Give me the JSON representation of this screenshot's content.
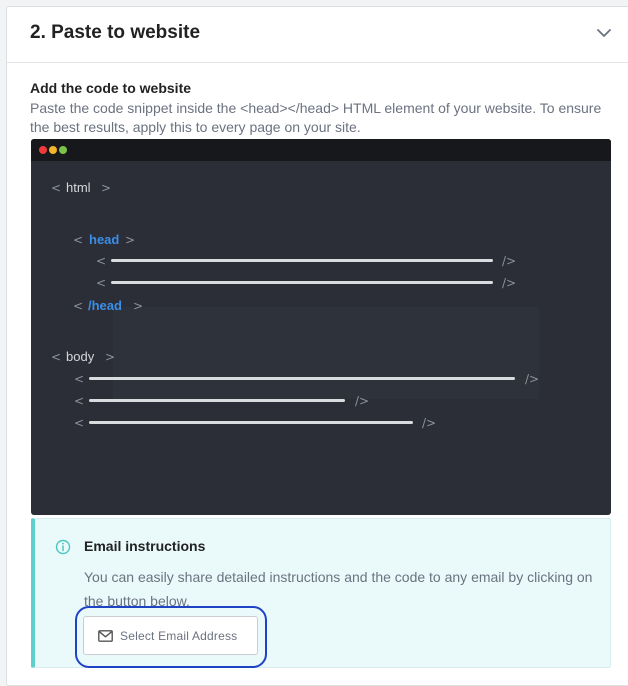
{
  "panel": {
    "title": "2. Paste to website",
    "toggle_icon": "chevron-down-icon"
  },
  "section": {
    "title": "Add the code to website",
    "description": "Paste the code snippet inside the <head></head> HTML element of your website. To ensure the best results, apply this to every page on your site."
  },
  "code_preview": {
    "window_controls": [
      "red",
      "yellow",
      "green"
    ],
    "html_tag": "html",
    "head_open_tag": "head",
    "head_close_tag": "/head",
    "body_tag": "body",
    "self_close": "/>",
    "colors": {
      "background": "#2b2e36",
      "highlight": "#3b8ee8"
    }
  },
  "email_instructions": {
    "title": "Email instructions",
    "text": "You can easily share detailed instructions and the code to any email by clicking on the button below.",
    "button_label": "Select Email Address",
    "icons": {
      "info": "info-icon",
      "mail": "mail-icon"
    },
    "accent_color": "#5fcfcc"
  }
}
